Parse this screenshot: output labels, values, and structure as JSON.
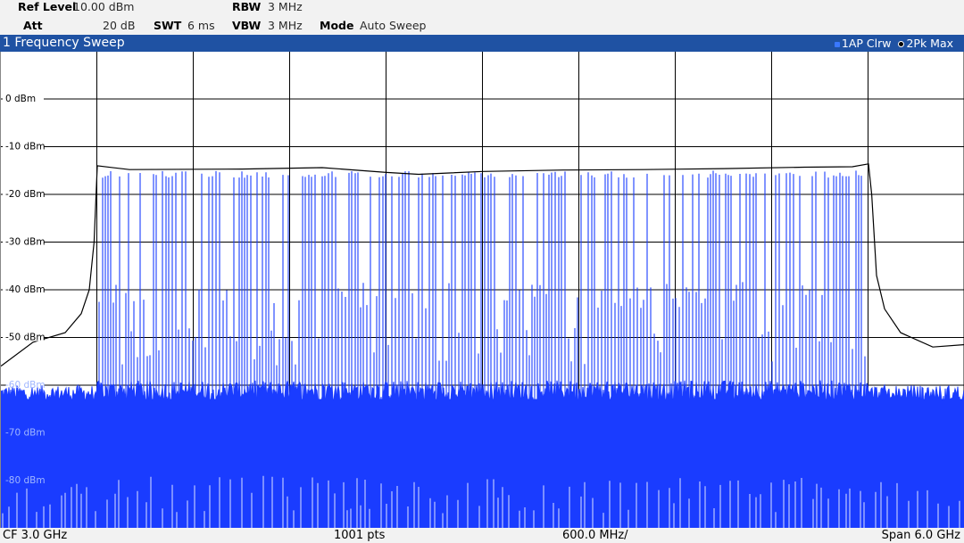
{
  "settings": {
    "ref_level_label": "Ref Level",
    "ref_level_value": "10.00 dBm",
    "att_label": "Att",
    "att_value": "20 dB",
    "swt_label": "SWT",
    "swt_value": "6 ms",
    "rbw_label": "RBW",
    "rbw_value": "3 MHz",
    "vbw_label": "VBW",
    "vbw_value": "3 MHz",
    "mode_label": "Mode",
    "mode_value": "Auto Sweep"
  },
  "window": {
    "title": "1 Frequency Sweep",
    "traces": [
      {
        "label": "1AP Clrw",
        "color": "#1a3cff"
      },
      {
        "label": "2Pk Max",
        "color": "#000000"
      }
    ]
  },
  "footer": {
    "center_freq": "CF 3.0 GHz",
    "points": "1001 pts",
    "per_div": "600.0 MHz/",
    "span": "Span 6.0 GHz"
  },
  "chart_data": {
    "type": "line",
    "title": "1 Frequency Sweep",
    "xlabel": "",
    "ylabel": "",
    "x_unit": "GHz",
    "y_unit": "dBm",
    "xlim": [
      0.0,
      6.0
    ],
    "ylim": [
      -90,
      10
    ],
    "y_tick_labels": [
      "0 dBm",
      "-10 dBm",
      "-20 dBm",
      "-30 dBm",
      "-40 dBm",
      "-50 dBm",
      "-60 dBm",
      "-70 dBm",
      "-80 dBm"
    ],
    "y_tick_values": [
      0,
      -10,
      -20,
      -30,
      -40,
      -50,
      -60,
      -70,
      -80
    ],
    "x_divisions": 10,
    "grid": true,
    "series": [
      {
        "name": "1AP Clrw",
        "color": "#1a3cff",
        "style": "dense-spectrum",
        "noise_floor_dbm": -63,
        "band_x": [
          0.6,
          5.4
        ],
        "band_peak_dbm": -15
      },
      {
        "name": "2Pk Max",
        "color": "#000000",
        "x": [
          0.0,
          0.2,
          0.4,
          0.5,
          0.55,
          0.58,
          0.6,
          0.8,
          1.5,
          2.0,
          2.4,
          2.6,
          3.0,
          3.5,
          4.0,
          4.5,
          5.0,
          5.3,
          5.4,
          5.42,
          5.45,
          5.5,
          5.6,
          5.8,
          6.0
        ],
        "y": [
          -56,
          -51,
          -49,
          -45,
          -40,
          -30,
          -14,
          -14.8,
          -14.7,
          -14.4,
          -15.4,
          -15.8,
          -15.2,
          -14.9,
          -14.8,
          -14.6,
          -14.3,
          -14.2,
          -13.6,
          -20,
          -37,
          -44,
          -49,
          -52,
          -51.5
        ]
      }
    ]
  }
}
